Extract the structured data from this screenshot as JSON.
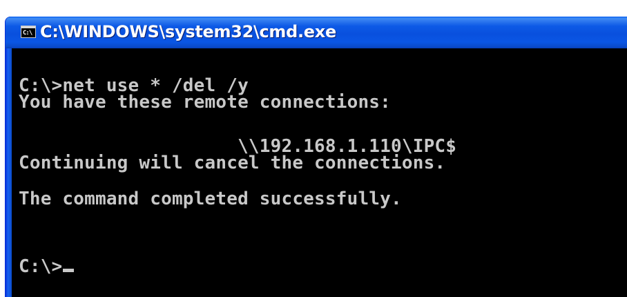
{
  "window": {
    "title": "C:\\WINDOWS\\system32\\cmd.exe",
    "icon_label": "C:\\"
  },
  "console": {
    "lines": [
      "C:\\>net use * /del /y",
      "You have these remote connections:",
      "",
      "                    \\\\192.168.1.110\\IPC$",
      "Continuing will cancel the connections.",
      "",
      "The command completed successfully.",
      "",
      "",
      "C:\\>"
    ],
    "text_color": "#c8c8c8",
    "background_color": "#000000"
  },
  "colors": {
    "titlebar": "#0a56e4",
    "title_text": "#ffffff"
  }
}
